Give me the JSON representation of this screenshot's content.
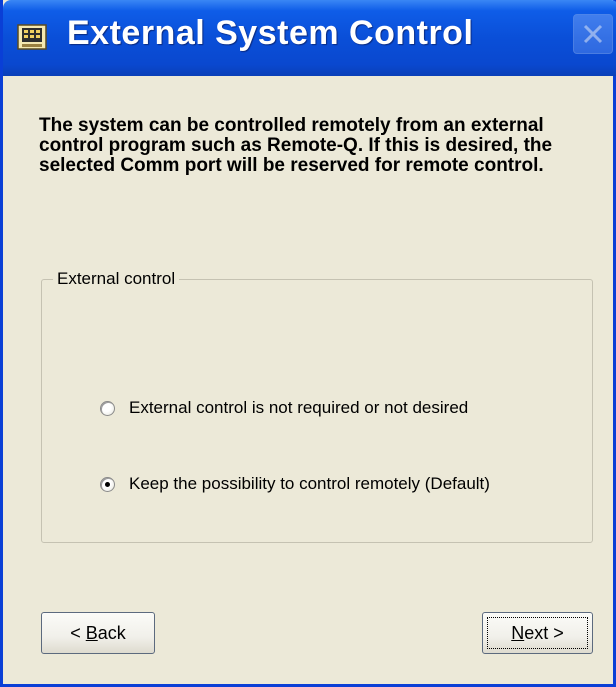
{
  "window": {
    "title": "External System Control"
  },
  "intro_text": "The system can be controlled remotely from an external control program such as Remote-Q. If this is desired, the selected Comm port will be reserved for remote control.",
  "group": {
    "legend": "External control",
    "options": [
      {
        "label": "External control is not required or not desired",
        "checked": false
      },
      {
        "label": "Keep the possibility to control remotely  (Default)",
        "checked": true
      }
    ]
  },
  "buttons": {
    "back": {
      "prefix": "< ",
      "mnemonic": "B",
      "rest": "ack"
    },
    "next": {
      "mnemonic": "N",
      "rest": "ext >"
    }
  }
}
